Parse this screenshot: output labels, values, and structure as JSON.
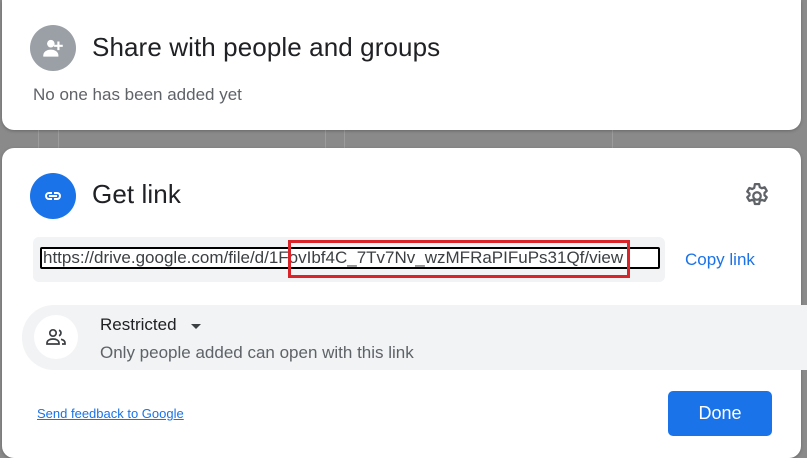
{
  "share": {
    "title": "Share with people and groups",
    "subtitle": "No one has been added yet",
    "avatar_icon": "add-person-icon"
  },
  "link": {
    "title": "Get link",
    "avatar_icon": "link-icon",
    "settings_icon": "gear-icon",
    "url": "https://drive.google.com/file/d/1FovIbf4C_7Tv7Nv_wzMFRaPIFuPs31Qf/view",
    "highlighted_segment": "1FovIbf4C_7Tv7Nv_wzMFRaPIFuPs31Qf/",
    "copy_label": "Copy link"
  },
  "access": {
    "icon": "people-icon",
    "level": "Restricted",
    "description": "Only people added can open with this link"
  },
  "footer": {
    "feedback_label": "Send feedback to Google",
    "done_label": "Done"
  },
  "colors": {
    "accent": "#1a73e8",
    "highlight": "#d9242a"
  }
}
